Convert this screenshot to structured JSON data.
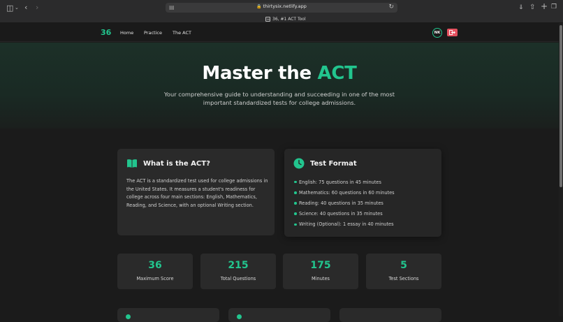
{
  "browser": {
    "url": "thirtysix.netlify.app",
    "tab_title": "36, #1 ACT Tool",
    "tab_favicon_text": "36"
  },
  "nav": {
    "logo": "36",
    "links": [
      "Home",
      "Practice",
      "The ACT"
    ],
    "avatar_initials": "NK"
  },
  "hero": {
    "title_main": "Master the ",
    "title_accent": "ACT",
    "subtitle": "Your comprehensive guide to understanding and succeeding in one of the most important standardized tests for college admissions."
  },
  "what_is": {
    "title": "What is the ACT?",
    "body": "The ACT is a standardized test used for college admissions in the United States. It measures a student's readiness for college across four main sections: English, Mathematics, Reading, and Science, with an optional Writing section."
  },
  "format": {
    "title": "Test Format",
    "items": [
      "English: 75 questions in 45 minutes",
      "Mathematics: 60 questions in 60 minutes",
      "Reading: 40 questions in 35 minutes",
      "Science: 40 questions in 35 minutes",
      "Writing (Optional): 1 essay in 40 minutes"
    ]
  },
  "stats": [
    {
      "value": "36",
      "label": "Maximum Score"
    },
    {
      "value": "215",
      "label": "Total Questions"
    },
    {
      "value": "175",
      "label": "Minutes"
    },
    {
      "value": "5",
      "label": "Test Sections"
    }
  ],
  "colors": {
    "accent": "#22c58e",
    "logout": "#e4505e",
    "background": "#1b1b1b",
    "card": "#2a2a2a"
  }
}
